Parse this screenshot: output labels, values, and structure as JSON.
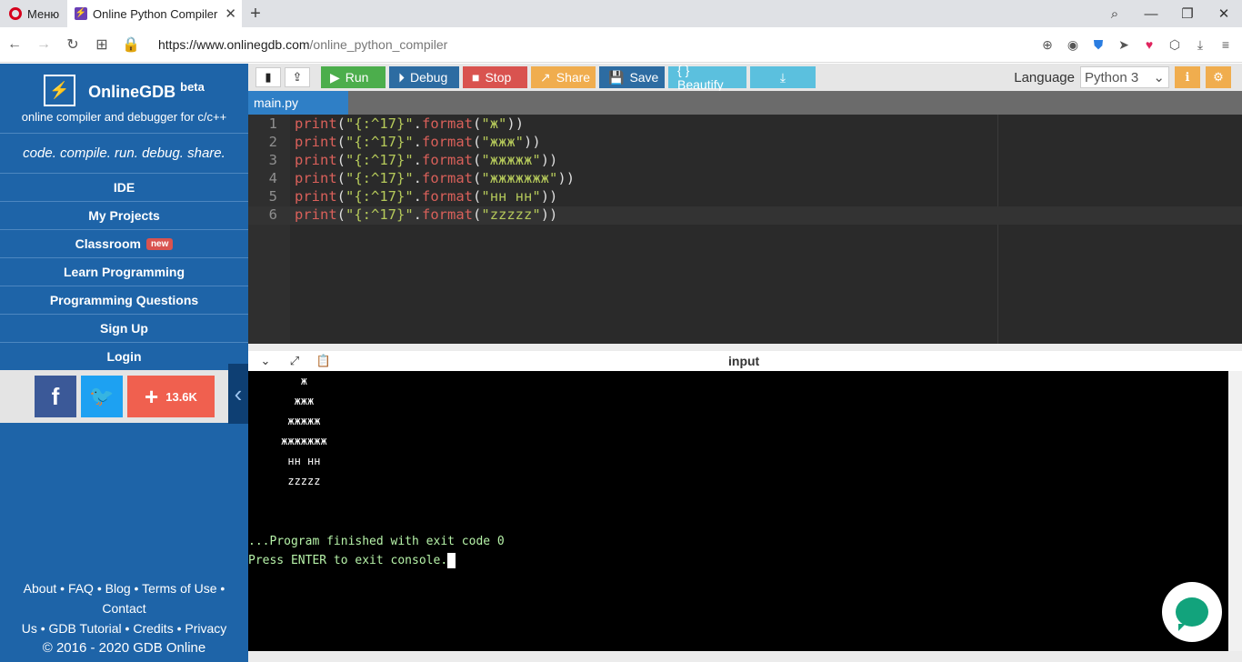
{
  "browser": {
    "menu_label": "Меню",
    "tab_title": "Online Python Compiler - c",
    "tab_close": "✕",
    "new_tab": "+",
    "url_host": "https://www.onlinegdb.com",
    "url_path": "/online_python_compiler"
  },
  "sidebar": {
    "brand": "OnlineGDB",
    "brand_suffix": "beta",
    "subtitle": "online compiler and debugger for c/c++",
    "tagline": "code. compile. run. debug. share.",
    "nav": [
      {
        "label": "IDE"
      },
      {
        "label": "My Projects"
      },
      {
        "label": "Classroom",
        "badge": "new"
      },
      {
        "label": "Learn Programming"
      },
      {
        "label": "Programming Questions"
      },
      {
        "label": "Sign Up"
      },
      {
        "label": "Login"
      }
    ],
    "share_count": "13.6K",
    "footer_line1": "About • FAQ • Blog • Terms of Use • Contact",
    "footer_line2": "Us • GDB Tutorial • Credits • Privacy",
    "footer_copy": "© 2016 - 2020 GDB Online"
  },
  "toolbar": {
    "run": "Run",
    "debug": "Debug",
    "stop": "Stop",
    "share": "Share",
    "save": "Save",
    "beautify": "{ } Beautify",
    "language_label": "Language",
    "language_value": "Python 3"
  },
  "file_tab": "main.py",
  "editor": {
    "lines": [
      {
        "num": "1",
        "arg": "\"ж\""
      },
      {
        "num": "2",
        "arg": "\"жжж\""
      },
      {
        "num": "3",
        "arg": "\"жжжжж\""
      },
      {
        "num": "4",
        "arg": "\"жжжжжжж\""
      },
      {
        "num": "5",
        "arg": "\"нн нн\""
      },
      {
        "num": "6",
        "arg": "\"zzzzz\""
      }
    ],
    "fmt_string": "\"{:^17}\""
  },
  "console": {
    "title": "input",
    "output": [
      "        ж",
      "       жжж",
      "      жжжжж",
      "     жжжжжжж",
      "      нн нн",
      "      zzzzz"
    ],
    "finished": "...Program finished with exit code 0",
    "prompt": "Press ENTER to exit console."
  }
}
